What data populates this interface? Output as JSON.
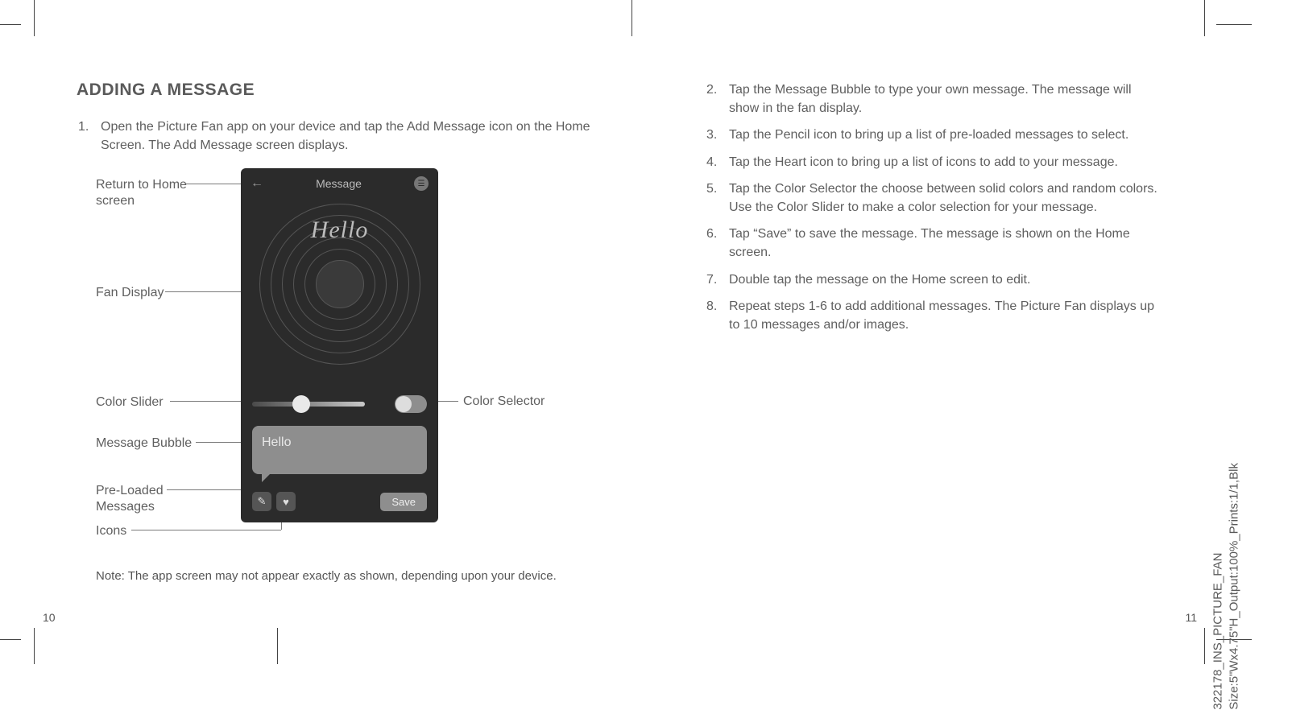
{
  "left": {
    "heading": "ADDING A MESSAGE",
    "step1_num": "1.",
    "step1": "Open the Picture Fan app on your device and tap the Add Message icon on the Home Screen. The Add Message screen displays.",
    "labels": {
      "return": "Return to Home screen",
      "fan": "Fan Display",
      "slider": "Color Slider",
      "bubble": "Message Bubble",
      "preloaded": "Pre-Loaded Messages",
      "icons": "Icons",
      "selector": "Color Selector"
    },
    "phone": {
      "title": "Message",
      "hello": "Hello",
      "bubble_text": "Hello",
      "save": "Save"
    },
    "note": "Note: The app screen may not appear exactly as shown, depending upon your device.",
    "pagenum": "10"
  },
  "right": {
    "steps": [
      {
        "n": "2.",
        "t": "Tap the Message Bubble to type your own message. The message will show in the fan display."
      },
      {
        "n": "3.",
        "t": "Tap the Pencil icon to bring up a list of pre-loaded messages to select."
      },
      {
        "n": "4.",
        "t": "Tap the Heart icon to bring up a list of icons to add to your message."
      },
      {
        "n": "5.",
        "t": "Tap the Color Selector the choose between solid colors and random colors. Use the Color Slider to make a color selection for your message."
      },
      {
        "n": "6.",
        "t": "Tap “Save” to save the message. The message is shown on the Home screen."
      },
      {
        "n": "7.",
        "t": "Double tap the message on the Home screen to edit."
      },
      {
        "n": "8.",
        "t": "Repeat steps 1-6 to add additional messages. The Picture Fan displays up to 10 messages and/or images."
      }
    ],
    "pagenum": "11"
  },
  "print_id_line1": "322178_INS_PICTURE_FAN",
  "print_id_line2": "Size:5\"Wx4.75\"H_Output:100%_Prints:1/1,Blk"
}
